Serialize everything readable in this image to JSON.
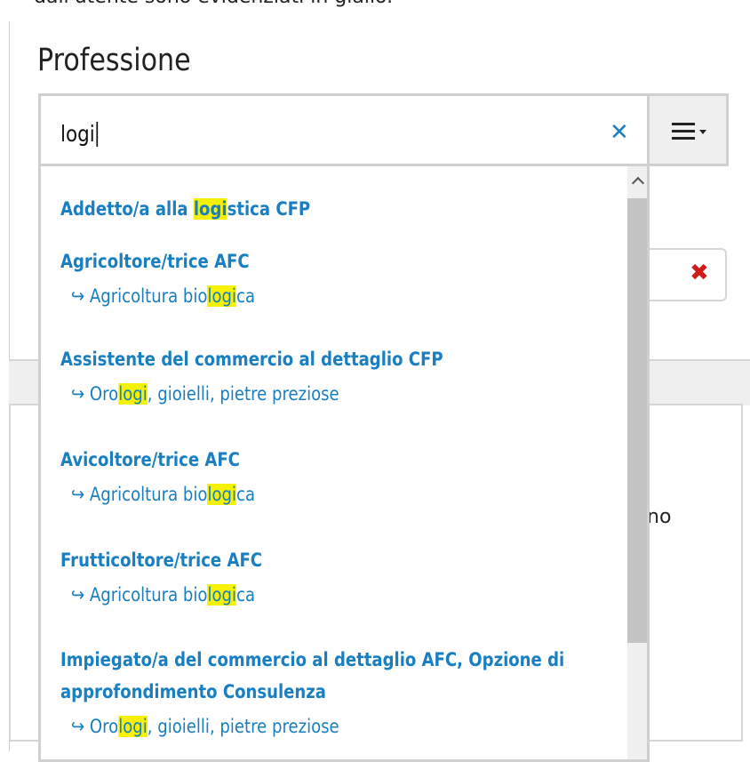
{
  "page": {
    "caption": "dall'utente sono evidenziati in giallo.",
    "heading": "Professione"
  },
  "search": {
    "value": "logi",
    "clear_icon": "close-icon",
    "menu_icon": "hamburger-menu-icon"
  },
  "background": {
    "remove_icon": "red-x-icon",
    "partial_text": "no"
  },
  "dropdown": {
    "arrow": "↪",
    "items": [
      {
        "title_pre": "Addetto/a alla ",
        "title_hl": "logi",
        "title_post": "stica CFP"
      },
      {
        "title": "Agricoltore/trice AFC",
        "sub_pre": "Agricoltura bio",
        "sub_hl": "logi",
        "sub_post": "ca"
      },
      {
        "title": "Assistente del commercio al dettaglio CFP",
        "sub_pre": "Oro",
        "sub_hl": "logi",
        "sub_post": ", gioielli, pietre preziose"
      },
      {
        "title": "Avicoltore/trice AFC",
        "sub_pre": "Agricoltura bio",
        "sub_hl": "logi",
        "sub_post": "ca"
      },
      {
        "title": "Frutticoltore/trice AFC",
        "sub_pre": "Agricoltura bio",
        "sub_hl": "logi",
        "sub_post": "ca"
      },
      {
        "title_line1": "Impiegato/a del commercio al dettaglio AFC, Opzione di",
        "title_line2": "approfondimento Consulenza",
        "sub_pre": "Oro",
        "sub_hl": "logi",
        "sub_post": ", gioielli, pietre preziose"
      }
    ]
  },
  "colors": {
    "link": "#1a7fc1",
    "highlight": "#f6f100",
    "remove": "#d01b1b"
  }
}
